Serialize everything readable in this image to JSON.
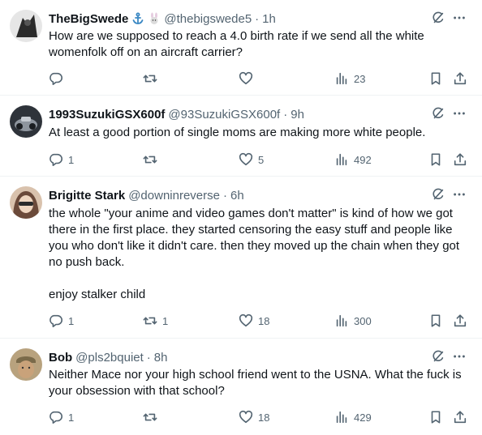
{
  "tweets": [
    {
      "name": "TheBigSwede",
      "badges": [
        "anchor-emoji",
        "rabbit-emoji"
      ],
      "handle": "@thebigswede5",
      "time": "1h",
      "text": "How are we supposed to reach a 4.0 birth rate if we send all the white womenfolk off on an aircraft carrier?",
      "replies": "",
      "retweets": "",
      "likes": "",
      "views": "23",
      "avatar_colors": [
        "#2b2b2b",
        "#d8d8d8"
      ]
    },
    {
      "name": "1993SuzukiGSX600f",
      "badges": [],
      "handle": "@93SuzukiGSX600f",
      "time": "9h",
      "text": "At least a good portion of single moms are making more white people.",
      "replies": "1",
      "retweets": "",
      "likes": "5",
      "views": "492",
      "avatar_colors": [
        "#3a4048",
        "#9aa0a8"
      ]
    },
    {
      "name": "Brigitte Stark",
      "badges": [],
      "handle": "@downinreverse",
      "time": "6h",
      "text": "the whole \"your anime and video games don't matter\" is kind of how we got there in the first place. they started censoring the easy stuff and people like you who don't like it didn't care. then they moved up the chain when they got no push back.\n\nenjoy stalker child",
      "replies": "1",
      "retweets": "1",
      "likes": "18",
      "views": "300",
      "avatar_colors": [
        "#6b4a3a",
        "#e8c9b0"
      ]
    },
    {
      "name": "Bob",
      "badges": [],
      "handle": "@pls2bquiet",
      "time": "8h",
      "text": "Neither Mace nor your high school friend went to the USNA. What the fuck is your obsession with that school?",
      "replies": "1",
      "retweets": "",
      "likes": "18",
      "views": "429",
      "avatar_colors": [
        "#7a6a4a",
        "#c9a27a"
      ]
    }
  ],
  "separator": "·",
  "colors": {
    "text": "#0f1419",
    "muted": "#536471",
    "border": "#eff3f4"
  }
}
